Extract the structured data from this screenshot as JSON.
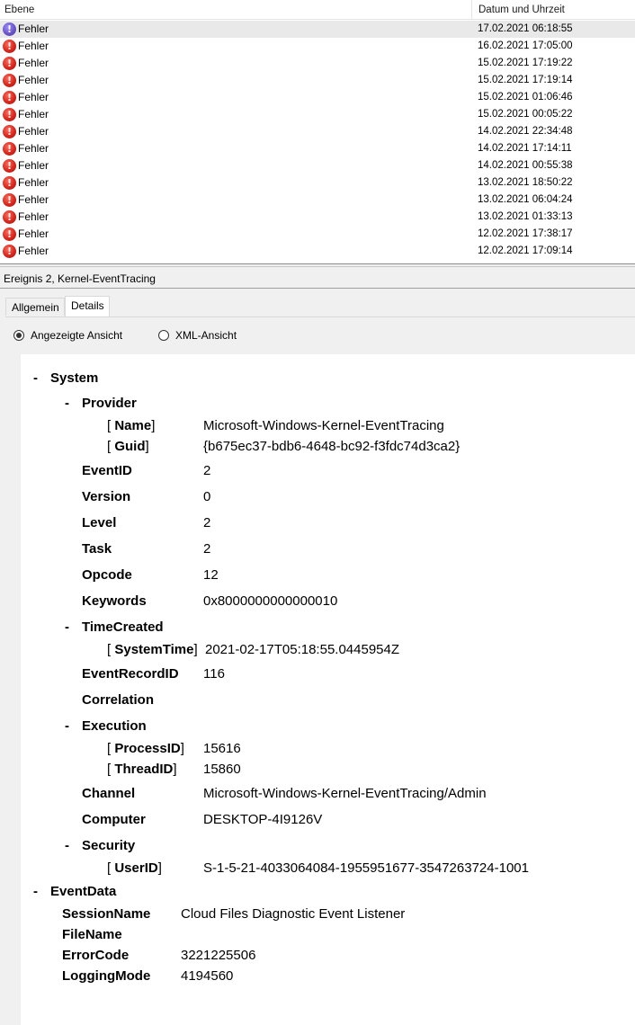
{
  "list": {
    "columns": {
      "level": "Ebene",
      "datetime": "Datum und Uhrzeit"
    },
    "rows": [
      {
        "level": "Fehler",
        "datetime": "17.02.2021 06:18:55"
      },
      {
        "level": "Fehler",
        "datetime": "16.02.2021 17:05:00"
      },
      {
        "level": "Fehler",
        "datetime": "15.02.2021 17:19:22"
      },
      {
        "level": "Fehler",
        "datetime": "15.02.2021 17:19:14"
      },
      {
        "level": "Fehler",
        "datetime": "15.02.2021 01:06:46"
      },
      {
        "level": "Fehler",
        "datetime": "15.02.2021 00:05:22"
      },
      {
        "level": "Fehler",
        "datetime": "14.02.2021 22:34:48"
      },
      {
        "level": "Fehler",
        "datetime": "14.02.2021 17:14:11"
      },
      {
        "level": "Fehler",
        "datetime": "14.02.2021 00:55:38"
      },
      {
        "level": "Fehler",
        "datetime": "13.02.2021 18:50:22"
      },
      {
        "level": "Fehler",
        "datetime": "13.02.2021 06:04:24"
      },
      {
        "level": "Fehler",
        "datetime": "13.02.2021 01:33:13"
      },
      {
        "level": "Fehler",
        "datetime": "12.02.2021 17:38:17"
      },
      {
        "level": "Fehler",
        "datetime": "12.02.2021 17:09:14"
      }
    ]
  },
  "pane": {
    "title": "Ereignis 2, Kernel-EventTracing",
    "tabs": [
      "Allgemein",
      "Details"
    ],
    "view_options": [
      "Angezeigte Ansicht",
      "XML-Ansicht"
    ]
  },
  "details": {
    "collapse_marker": "-",
    "bracket_open": "[",
    "bracket_close": "]",
    "system": {
      "label": "System",
      "provider": {
        "label": "Provider",
        "name_key": "Name",
        "name_val": "Microsoft-Windows-Kernel-EventTracing",
        "guid_key": "Guid",
        "guid_val": "{b675ec37-bdb6-4648-bc92-f3fdc74d3ca2}"
      },
      "eventid": {
        "key": "EventID",
        "val": "2"
      },
      "version": {
        "key": "Version",
        "val": "0"
      },
      "level": {
        "key": "Level",
        "val": "2"
      },
      "task": {
        "key": "Task",
        "val": "2"
      },
      "opcode": {
        "key": "Opcode",
        "val": "12"
      },
      "keywords": {
        "key": "Keywords",
        "val": "0x8000000000000010"
      },
      "timecreated": {
        "label": "TimeCreated",
        "systemtime_key": "SystemTime",
        "systemtime_val": "2021-02-17T05:18:55.0445954Z"
      },
      "eventrecordid": {
        "key": "EventRecordID",
        "val": "116"
      },
      "correlation": {
        "key": "Correlation"
      },
      "execution": {
        "label": "Execution",
        "processid_key": "ProcessID",
        "processid_val": "15616",
        "threadid_key": "ThreadID",
        "threadid_val": "15860"
      },
      "channel": {
        "key": "Channel",
        "val": "Microsoft-Windows-Kernel-EventTracing/Admin"
      },
      "computer": {
        "key": "Computer",
        "val": "DESKTOP-4I9126V"
      },
      "security": {
        "label": "Security",
        "userid_key": "UserID",
        "userid_val": "S-1-5-21-4033064084-1955951677-3547263724-1001"
      }
    },
    "eventdata": {
      "label": "EventData",
      "sessionname": {
        "key": "SessionName",
        "val": "Cloud Files Diagnostic Event Listener"
      },
      "filename": {
        "key": "FileName"
      },
      "errorcode": {
        "key": "ErrorCode",
        "val": "3221225506"
      },
      "loggingmode": {
        "key": "LoggingMode",
        "val": "4194560"
      }
    }
  }
}
